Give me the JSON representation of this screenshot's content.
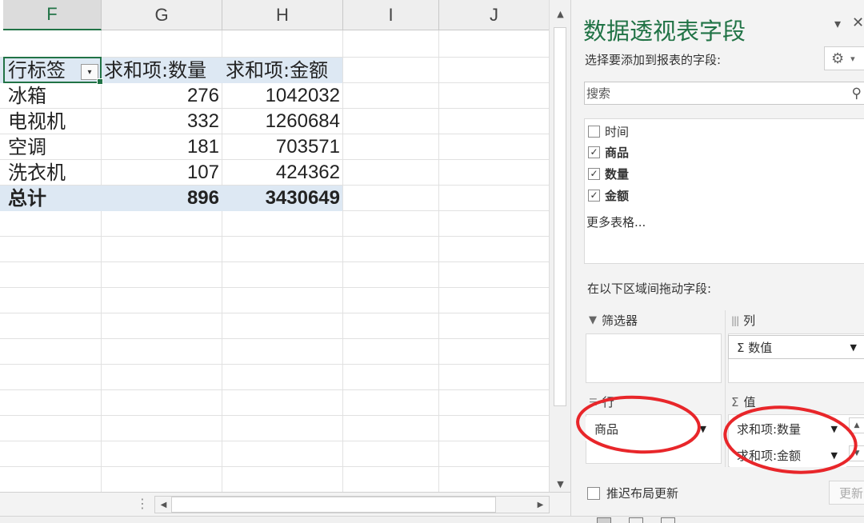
{
  "sheet": {
    "columns": [
      {
        "letter": "F",
        "selected": true
      },
      {
        "letter": "G",
        "selected": false
      },
      {
        "letter": "H",
        "selected": false
      },
      {
        "letter": "I",
        "selected": false
      },
      {
        "letter": "J",
        "selected": false
      }
    ],
    "pivot": {
      "headers": [
        "行标签",
        "求和项:数量",
        "求和项:金额"
      ],
      "rows": [
        {
          "label": "冰箱",
          "qty": "276",
          "amount": "1042032"
        },
        {
          "label": "电视机",
          "qty": "332",
          "amount": "1260684"
        },
        {
          "label": "空调",
          "qty": "181",
          "amount": "703571"
        },
        {
          "label": "洗衣机",
          "qty": "107",
          "amount": "424362"
        }
      ],
      "total": {
        "label": "总计",
        "qty": "896",
        "amount": "3430649"
      }
    }
  },
  "pane": {
    "title": "数据透视表字段",
    "subtitle": "选择要添加到报表的字段:",
    "search_placeholder": "搜索",
    "fields": [
      {
        "name": "时间",
        "checked": false
      },
      {
        "name": "商品",
        "checked": true
      },
      {
        "name": "数量",
        "checked": true
      },
      {
        "name": "金额",
        "checked": true
      }
    ],
    "more_tables": "更多表格...",
    "drag_label": "在以下区域间拖动字段:",
    "areas": {
      "filter": {
        "label": "筛选器"
      },
      "columns": {
        "label": "列",
        "items": [
          "Σ 数值"
        ]
      },
      "rows": {
        "label": "行",
        "items": [
          "商品"
        ]
      },
      "values": {
        "label": "值",
        "items": [
          "求和项:数量",
          "求和项:金额"
        ]
      }
    },
    "defer_label": "推迟布局更新",
    "update_label": "更新"
  },
  "colors": {
    "accent": "#217346",
    "pivot_band": "#dde8f3",
    "annotation": "#e8262a"
  },
  "icons": {
    "filter": "filter-icon",
    "columns": "columns-icon",
    "rows": "rows-icon",
    "values": "sigma-icon",
    "gear": "gear-icon",
    "search": "search-icon",
    "close": "close-icon"
  }
}
